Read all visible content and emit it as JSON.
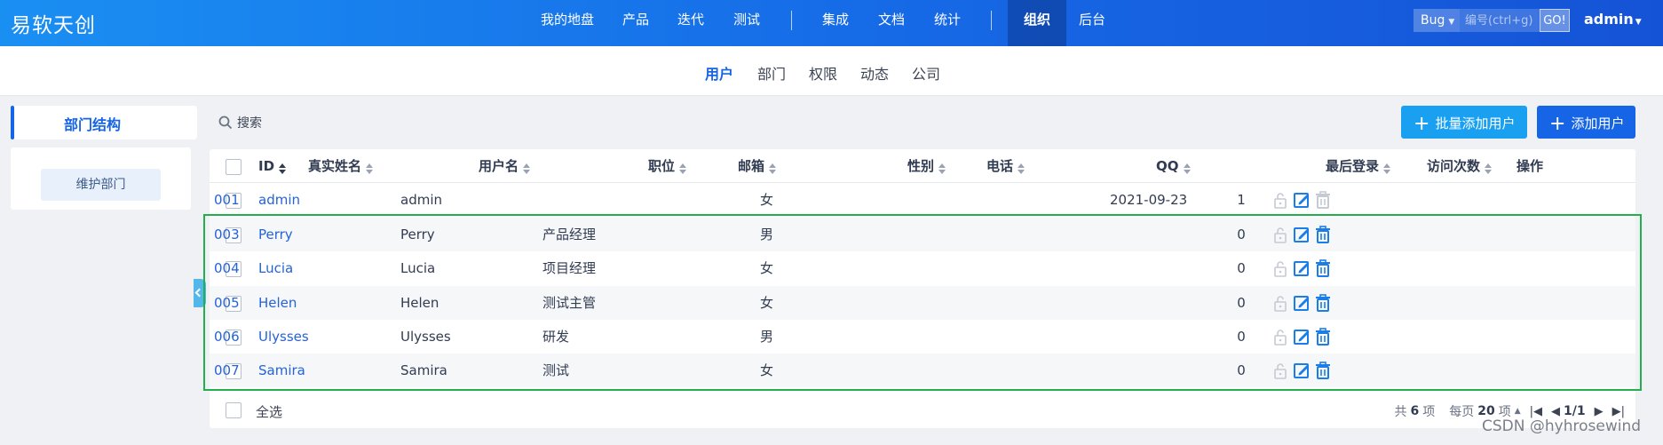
{
  "header": {
    "brand": "易软天创",
    "nav": [
      "我的地盘",
      "产品",
      "迭代",
      "测试",
      "集成",
      "文档",
      "统计",
      "组织",
      "后台"
    ],
    "active_nav": "组织",
    "search_type": "Bug",
    "search_placeholder": "编号(ctrl+g)",
    "search_go": "GO!",
    "user": "admin"
  },
  "subnav": {
    "items": [
      "用户",
      "部门",
      "权限",
      "动态",
      "公司"
    ],
    "active": "用户"
  },
  "sidebar": {
    "title": "部门结构",
    "maintain_button": "维护部门"
  },
  "toolbar": {
    "search_label": "搜索",
    "batch_add_label": "批量添加用户",
    "add_label": "添加用户"
  },
  "table": {
    "columns": [
      "ID",
      "真实姓名",
      "用户名",
      "职位",
      "邮箱",
      "性别",
      "电话",
      "QQ",
      "最后登录",
      "访问次数",
      "操作"
    ],
    "rows": [
      {
        "id": "001",
        "realname": "admin",
        "account": "admin",
        "role": "",
        "email": "",
        "gender": "女",
        "phone": "",
        "qq": "",
        "last_login": "2021-09-23",
        "visits": "1"
      },
      {
        "id": "003",
        "realname": "Perry",
        "account": "Perry",
        "role": "产品经理",
        "email": "",
        "gender": "男",
        "phone": "",
        "qq": "",
        "last_login": "",
        "visits": "0"
      },
      {
        "id": "004",
        "realname": "Lucia",
        "account": "Lucia",
        "role": "项目经理",
        "email": "",
        "gender": "女",
        "phone": "",
        "qq": "",
        "last_login": "",
        "visits": "0"
      },
      {
        "id": "005",
        "realname": "Helen",
        "account": "Helen",
        "role": "测试主管",
        "email": "",
        "gender": "女",
        "phone": "",
        "qq": "",
        "last_login": "",
        "visits": "0"
      },
      {
        "id": "006",
        "realname": "Ulysses",
        "account": "Ulysses",
        "role": "研发",
        "email": "",
        "gender": "男",
        "phone": "",
        "qq": "",
        "last_login": "",
        "visits": "0"
      },
      {
        "id": "007",
        "realname": "Samira",
        "account": "Samira",
        "role": "测试",
        "email": "",
        "gender": "女",
        "phone": "",
        "qq": "",
        "last_login": "",
        "visits": "0"
      }
    ],
    "select_all": "全选",
    "pager": {
      "total_prefix": "共",
      "total": "6",
      "total_suffix": "项",
      "per_page_prefix": "每页",
      "per_page": "20",
      "per_page_suffix": "项",
      "page": "1/1"
    }
  },
  "colors": {
    "primary": "#1565e6",
    "header_gradient_start": "#1a8ff2",
    "batch_button": "#1aa0f0",
    "link": "#2463d8",
    "highlight_border": "#21b04b"
  },
  "watermark": "CSDN @hyhrosewind"
}
